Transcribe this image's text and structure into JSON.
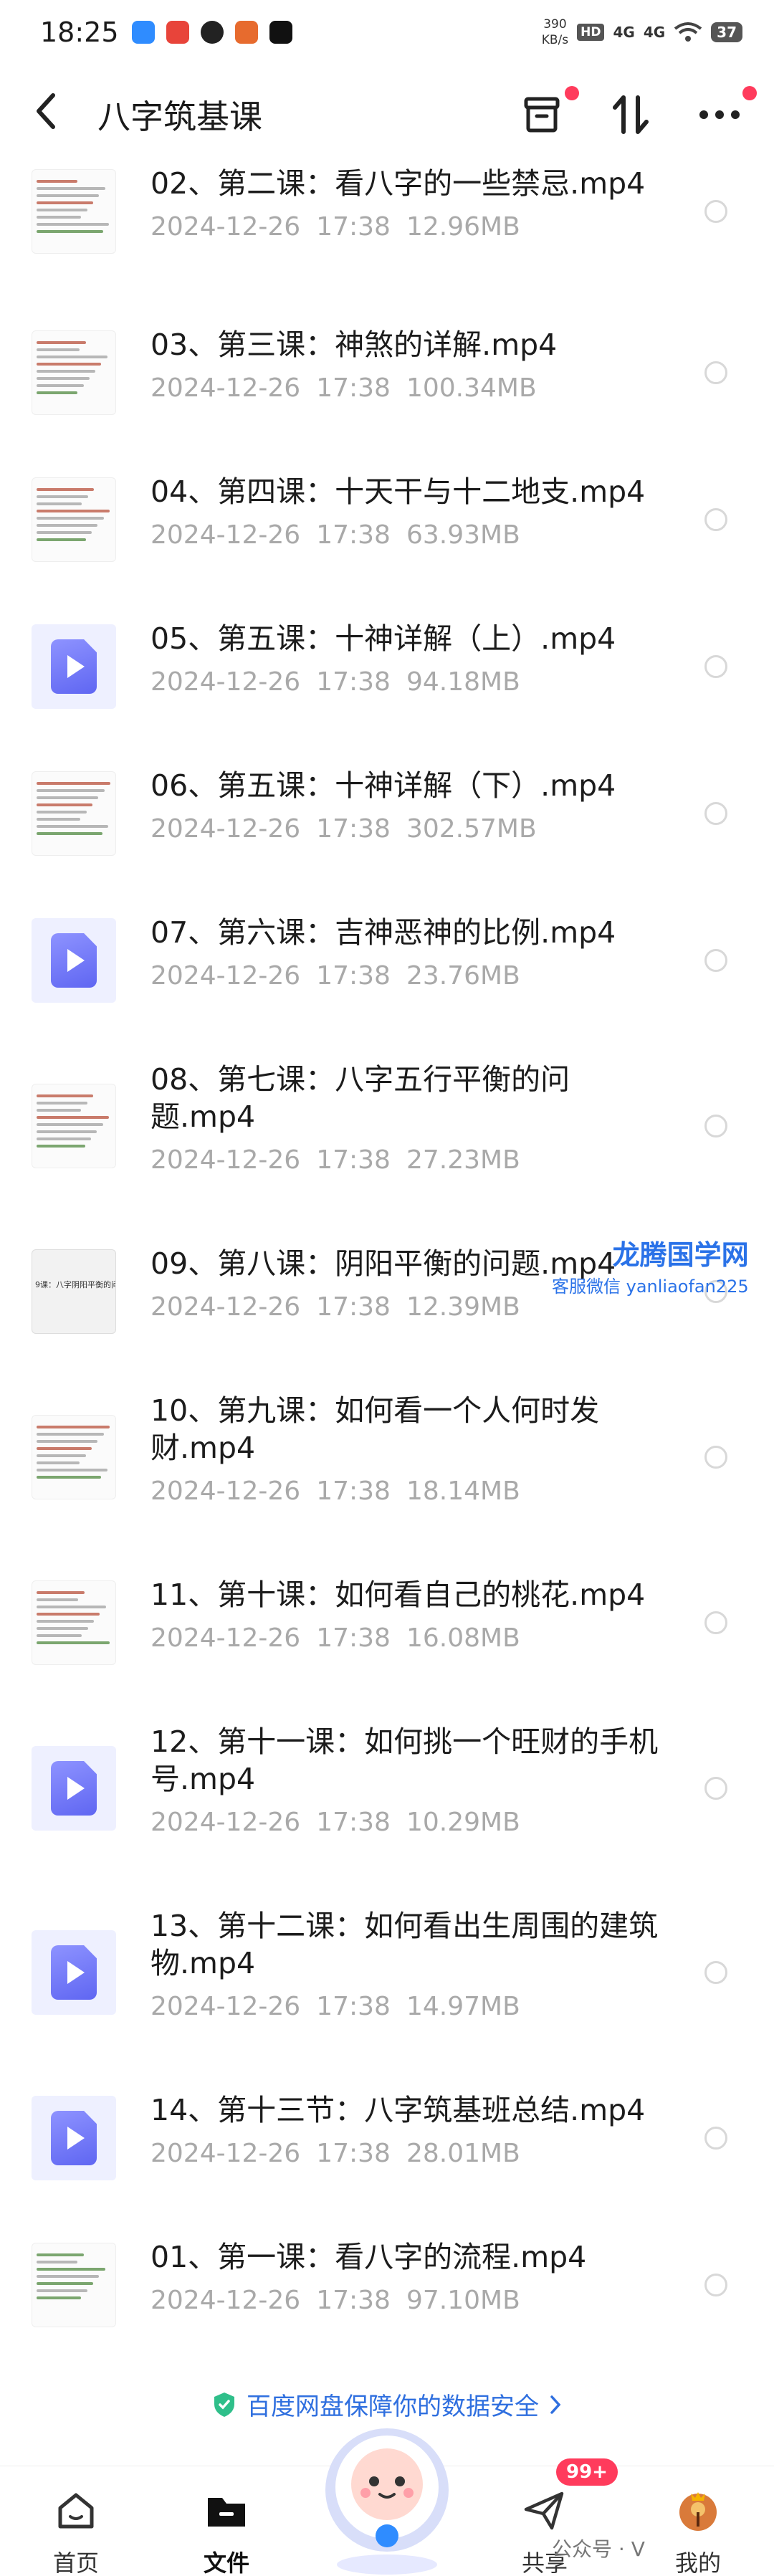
{
  "status_bar": {
    "time": "18:25",
    "net_speed_value": "390",
    "net_speed_unit": "KB/s",
    "hd": "HD",
    "sim1": "4G",
    "sim2": "4G",
    "battery": "37"
  },
  "header": {
    "title": "八字筑基课",
    "back_icon": "chevron-left-icon",
    "archive_icon": "archive-icon",
    "sort_icon": "sort-icon",
    "more_icon": "more-icon"
  },
  "files": [
    {
      "name": "02、第二课：看八字的一些禁忌.mp4",
      "date": "2024-12-26",
      "time": "17:38",
      "size": "12.96MB",
      "thumb": "doc"
    },
    {
      "name": "03、第三课：神煞的详解.mp4",
      "date": "2024-12-26",
      "time": "17:38",
      "size": "100.34MB",
      "thumb": "doc"
    },
    {
      "name": "04、第四课：十天干与十二地支.mp4",
      "date": "2024-12-26",
      "time": "17:38",
      "size": "63.93MB",
      "thumb": "doc"
    },
    {
      "name": "05、第五课：十神详解（上）.mp4",
      "date": "2024-12-26",
      "time": "17:38",
      "size": "94.18MB",
      "thumb": "video"
    },
    {
      "name": "06、第五课：十神详解（下）.mp4",
      "date": "2024-12-26",
      "time": "17:38",
      "size": "302.57MB",
      "thumb": "doc"
    },
    {
      "name": "07、第六课：吉神恶神的比例.mp4",
      "date": "2024-12-26",
      "time": "17:38",
      "size": "23.76MB",
      "thumb": "video"
    },
    {
      "name": "08、第七课：八字五行平衡的问题.mp4",
      "date": "2024-12-26",
      "time": "17:38",
      "size": "27.23MB",
      "thumb": "doc"
    },
    {
      "name": "09、第八课：阴阳平衡的问题.mp4",
      "date": "2024-12-26",
      "time": "17:38",
      "size": "12.39MB",
      "thumb": "banner"
    },
    {
      "name": "10、第九课：如何看一个人何时发财.mp4",
      "date": "2024-12-26",
      "time": "17:38",
      "size": "18.14MB",
      "thumb": "doc"
    },
    {
      "name": "11、第十课：如何看自己的桃花.mp4",
      "date": "2024-12-26",
      "time": "17:38",
      "size": "16.08MB",
      "thumb": "doc"
    },
    {
      "name": "12、第十一课：如何挑一个旺财的手机号.mp4",
      "date": "2024-12-26",
      "time": "17:38",
      "size": "10.29MB",
      "thumb": "video"
    },
    {
      "name": "13、第十二课：如何看出生周围的建筑物.mp4",
      "date": "2024-12-26",
      "time": "17:38",
      "size": "14.97MB",
      "thumb": "video"
    },
    {
      "name": "14、第十三节：八字筑基班总结.mp4",
      "date": "2024-12-26",
      "time": "17:38",
      "size": "28.01MB",
      "thumb": "video"
    },
    {
      "name": "01、第一课：看八字的流程.mp4",
      "date": "2024-12-26",
      "time": "17:38",
      "size": "97.10MB",
      "thumb": "chat"
    }
  ],
  "banner_thumb_text": "9课：八字阴阳平衡的问",
  "watermark": {
    "line1": "龙腾国学网",
    "line2": "客服微信 yanliaofan225"
  },
  "security_notice": "百度网盘保障你的数据安全",
  "tabbar": {
    "home": "首页",
    "files": "文件",
    "share": "共享",
    "mine": "我的",
    "share_badge": "99+",
    "wechat_tag": "公众号 · V"
  },
  "colors": {
    "accent": "#2f6fdf",
    "video_icon": "#6b70f5",
    "badge": "#ff3b5c"
  }
}
